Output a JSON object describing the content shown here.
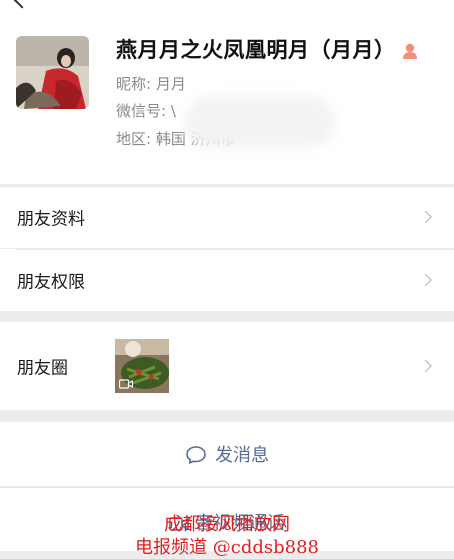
{
  "profile": {
    "display_name": "燕月月之火凤凰明月（月月）",
    "nickname_label": "昵称:",
    "nickname_value": "月月",
    "wechat_id_label": "微信号:",
    "wechat_id_value": "\\",
    "region_label": "地区:",
    "region_value": "韩国  济州市"
  },
  "rows": {
    "friend_info": "朋友资料",
    "friend_permissions": "朋友权限",
    "moments": "朋友圈"
  },
  "actions": {
    "send_message": "发消息",
    "video_call": "音视频通话"
  },
  "watermark": {
    "line1": "成都接风播放网",
    "line2": "电报频道 @cddsb888"
  },
  "colors": {
    "link_blue": "#576b95",
    "gender_orange": "#f0907a",
    "watermark_red": "#e0201f"
  }
}
